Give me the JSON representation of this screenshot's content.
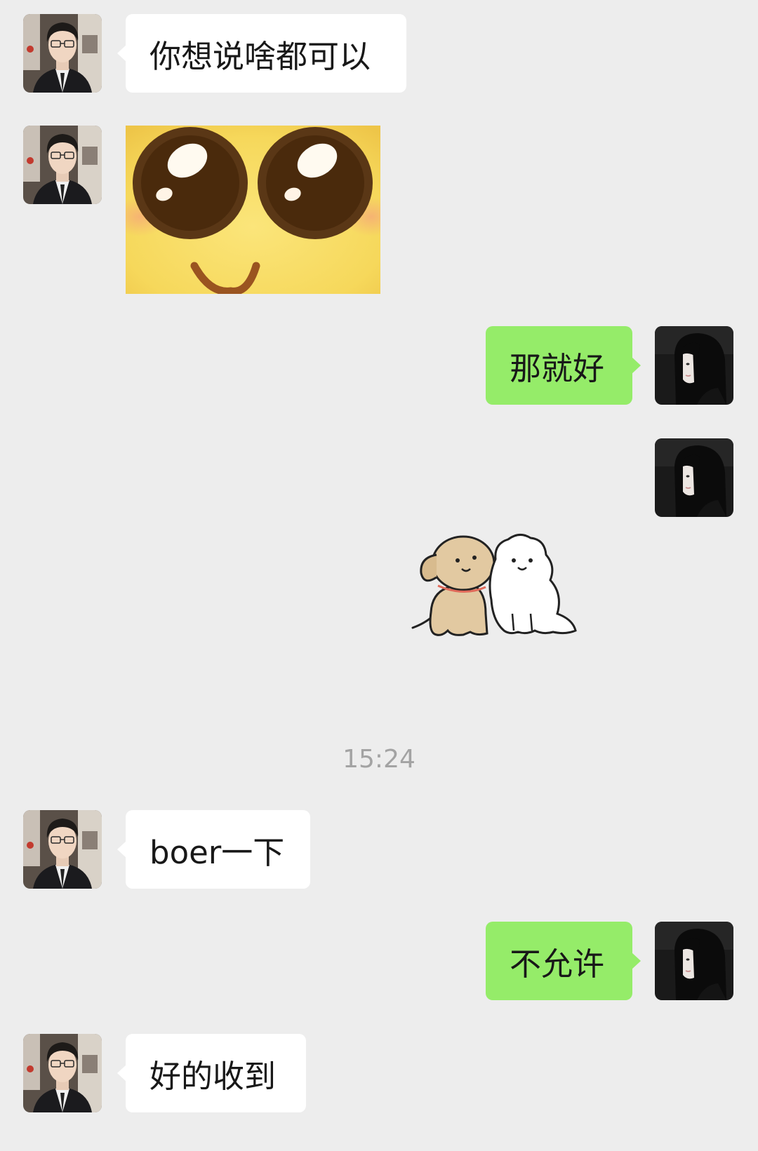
{
  "messages": [
    {
      "sender": "contact",
      "type": "text",
      "text": "你想说啥都可以"
    },
    {
      "sender": "contact",
      "type": "sticker",
      "sticker": "cute-eyes-face-sticker"
    },
    {
      "sender": "me",
      "type": "text",
      "text": "那就好"
    },
    {
      "sender": "me",
      "type": "sticker",
      "sticker": "two-puppies-sticker"
    },
    {
      "sender": "contact",
      "type": "text",
      "text": "boer一下"
    },
    {
      "sender": "me",
      "type": "text",
      "text": "不允许"
    },
    {
      "sender": "contact",
      "type": "text",
      "text": "好的收到"
    }
  ],
  "timestamp": "15:24",
  "colors": {
    "background": "#ededed",
    "incoming_bubble": "#ffffff",
    "outgoing_bubble": "#95ec69"
  }
}
